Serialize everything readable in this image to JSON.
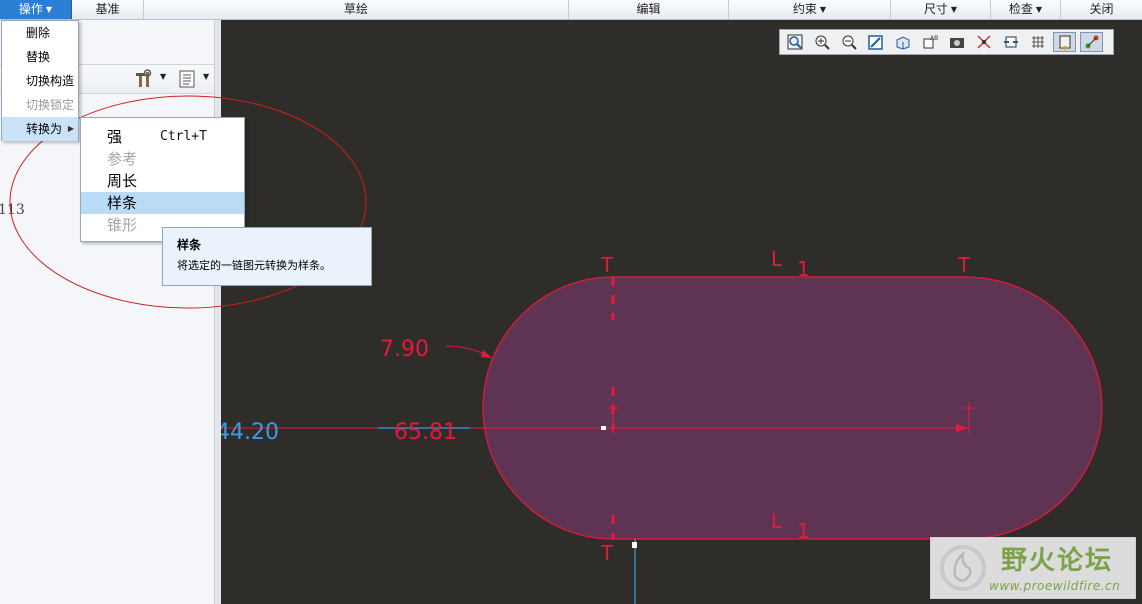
{
  "ribbon": {
    "groups": [
      {
        "label": "操作",
        "dropdown": true
      },
      {
        "label": "基准",
        "dropdown": false
      },
      {
        "label": "草绘",
        "dropdown": false
      },
      {
        "label": "编辑",
        "dropdown": false
      },
      {
        "label": "约束",
        "dropdown": true
      },
      {
        "label": "尺寸",
        "dropdown": true
      },
      {
        "label": "检查",
        "dropdown": true
      },
      {
        "label": "关闭",
        "dropdown": false
      }
    ]
  },
  "operations_menu": {
    "items": [
      {
        "label": "删除",
        "enabled": true
      },
      {
        "label": "替换",
        "enabled": true
      },
      {
        "label": "切换构造",
        "enabled": true
      },
      {
        "label": "切换锁定",
        "enabled": false
      },
      {
        "label": "转换为",
        "enabled": true,
        "submenu": true,
        "highlighted": true
      }
    ]
  },
  "convert_submenu": {
    "items": [
      {
        "label": "强",
        "shortcut": "Ctrl+T",
        "enabled": true
      },
      {
        "label": "参考",
        "enabled": false
      },
      {
        "label": "周长",
        "enabled": true
      },
      {
        "label": "样条",
        "enabled": true,
        "highlighted": true
      },
      {
        "label": "锥形",
        "enabled": false
      }
    ]
  },
  "tooltip": {
    "title": "样条",
    "description": "将选定的一链图元转换为样条。"
  },
  "left_panel": {
    "partial_value": "113"
  },
  "view_toolbar": {
    "icons": [
      "refit-icon",
      "zoom-in-icon",
      "zoom-out-icon",
      "repaint-icon",
      "saved-orientations-icon",
      "display-style-icon",
      "named-views-icon",
      "dimension-display-icon",
      "constraint-display-icon",
      "grid-display-icon",
      "vertex-display-icon",
      "sketch-view-icon",
      "snap-icon"
    ]
  },
  "sketch": {
    "dimensions": {
      "radius": "7.90",
      "length": "65.81",
      "offset": "44.20"
    },
    "constraint_labels": {
      "tangent": "T",
      "equal_length": "L",
      "index": "1"
    }
  },
  "watermark": {
    "title": "野火论坛",
    "url": "www.proewildfire.cn"
  },
  "colors": {
    "ribbon_active": "#2a7fd4",
    "canvas_bg": "#2e2d29",
    "sketch_red": "#e8173c",
    "sketch_fill": "#5f3453",
    "dimension_blue": "#3d9ae6",
    "menu_highlight": "#b9dbf5",
    "annotation_ellipse": "#d21d1d"
  }
}
